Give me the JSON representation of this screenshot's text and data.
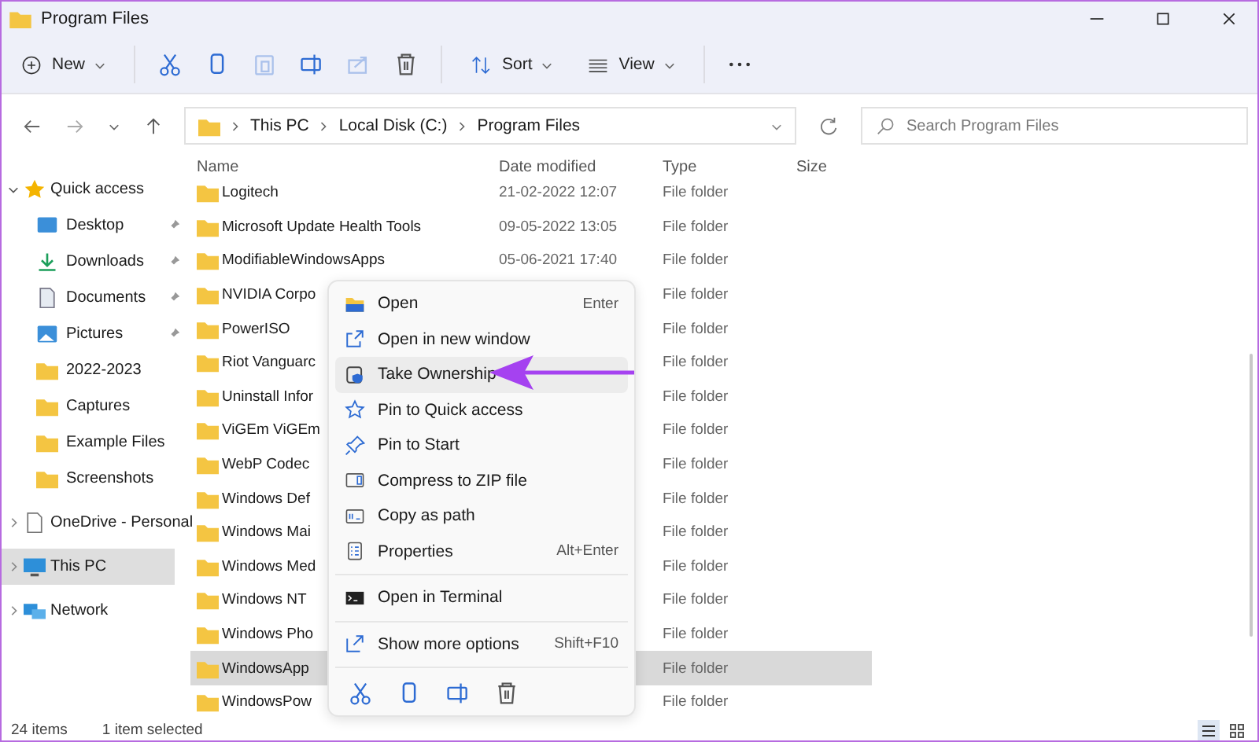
{
  "window": {
    "title": "Program Files"
  },
  "toolbar": {
    "new_button": {
      "label": "New"
    },
    "edit_actions": [
      {
        "disabled": false
      },
      {
        "disabled": false
      },
      {
        "disabled": true
      },
      {
        "disabled": false
      },
      {
        "disabled": true
      },
      {
        "disabled": false
      }
    ],
    "sort_button": {
      "label": "Sort"
    },
    "view_button": {
      "label": "View"
    }
  },
  "address_bar": {
    "breadcrumbs": [
      "This PC",
      "Local Disk (C:)",
      "Program Files"
    ]
  },
  "search": {
    "placeholder": "Search Program Files"
  },
  "sidebar": {
    "items": [
      {
        "label": "Quick access",
        "kind": "star",
        "expanded": true,
        "selected": false,
        "children": [
          {
            "label": "Desktop",
            "kind": "desktop",
            "pinned": true,
            "selected": false
          },
          {
            "label": "Downloads",
            "kind": "download",
            "pinned": true,
            "selected": false
          },
          {
            "label": "Documents",
            "kind": "document",
            "pinned": true,
            "selected": false
          },
          {
            "label": "Pictures",
            "kind": "picture",
            "pinned": true,
            "selected": false
          },
          {
            "label": "2022-2023",
            "kind": "folder",
            "pinned": false,
            "selected": false
          },
          {
            "label": "Captures",
            "kind": "folder",
            "pinned": false,
            "selected": false
          },
          {
            "label": "Example Files",
            "kind": "folder",
            "pinned": false,
            "selected": false
          },
          {
            "label": "Screenshots",
            "kind": "folder",
            "pinned": false,
            "selected": false
          }
        ]
      },
      {
        "label": "OneDrive - Personal",
        "kind": "cloud",
        "expanded": false,
        "selected": false
      },
      {
        "label": "This PC",
        "kind": "pc",
        "expanded": false,
        "selected": true
      },
      {
        "label": "Network",
        "kind": "network",
        "expanded": false,
        "selected": false
      }
    ]
  },
  "table": {
    "columns": [
      "Name",
      "Date modified",
      "Type",
      "Size"
    ],
    "rows": [
      {
        "name": "Logitech",
        "date": "21-02-2022 12:07",
        "type": "File folder",
        "selected": false
      },
      {
        "name": "Microsoft Update Health Tools",
        "date": "09-05-2022 13:05",
        "type": "File folder",
        "selected": false
      },
      {
        "name": "ModifiableWindowsApps",
        "date": "05-06-2021 17:40",
        "type": "File folder",
        "selected": false
      },
      {
        "name": "NVIDIA Corpo",
        "type": "File folder",
        "selected": false
      },
      {
        "name": "PowerISO",
        "type": "File folder",
        "selected": false
      },
      {
        "name": "Riot Vanguarc",
        "type": "File folder",
        "selected": false
      },
      {
        "name": "Uninstall Infor",
        "type": "File folder",
        "selected": false
      },
      {
        "name": "ViGEm ViGEm",
        "type": "File folder",
        "selected": false
      },
      {
        "name": "WebP Codec",
        "type": "File folder",
        "selected": false
      },
      {
        "name": "Windows Def",
        "type": "File folder",
        "selected": false
      },
      {
        "name": "Windows Mai",
        "type": "File folder",
        "selected": false
      },
      {
        "name": "Windows Med",
        "type": "File folder",
        "selected": false
      },
      {
        "name": "Windows NT",
        "type": "File folder",
        "selected": false
      },
      {
        "name": "Windows Pho",
        "type": "File folder",
        "selected": false
      },
      {
        "name": "WindowsApp",
        "type": "File folder",
        "selected": true
      },
      {
        "name": "WindowsPow",
        "type": "File folder",
        "selected": false
      }
    ]
  },
  "context_menu": {
    "groups": [
      [
        {
          "label": "Open",
          "shortcut": "Enter",
          "selected": false
        },
        {
          "label": "Open in new window",
          "selected": false
        },
        {
          "label": "Take Ownership",
          "selected": true
        },
        {
          "label": "Pin to Quick access",
          "selected": false
        },
        {
          "label": "Pin to Start",
          "selected": false
        },
        {
          "label": "Compress to ZIP file",
          "selected": false
        },
        {
          "label": "Copy as path",
          "selected": false
        },
        {
          "label": "Properties",
          "shortcut": "Alt+Enter",
          "selected": false
        }
      ],
      [
        {
          "label": "Open in Terminal",
          "selected": false
        }
      ],
      [
        {
          "label": "Show more options",
          "shortcut": "Shift+F10",
          "selected": false
        }
      ]
    ]
  },
  "status_bar": {
    "item_count": "24 items",
    "selection": "1 item selected",
    "views": [
      {
        "selected": true
      },
      {
        "selected": false
      }
    ]
  }
}
